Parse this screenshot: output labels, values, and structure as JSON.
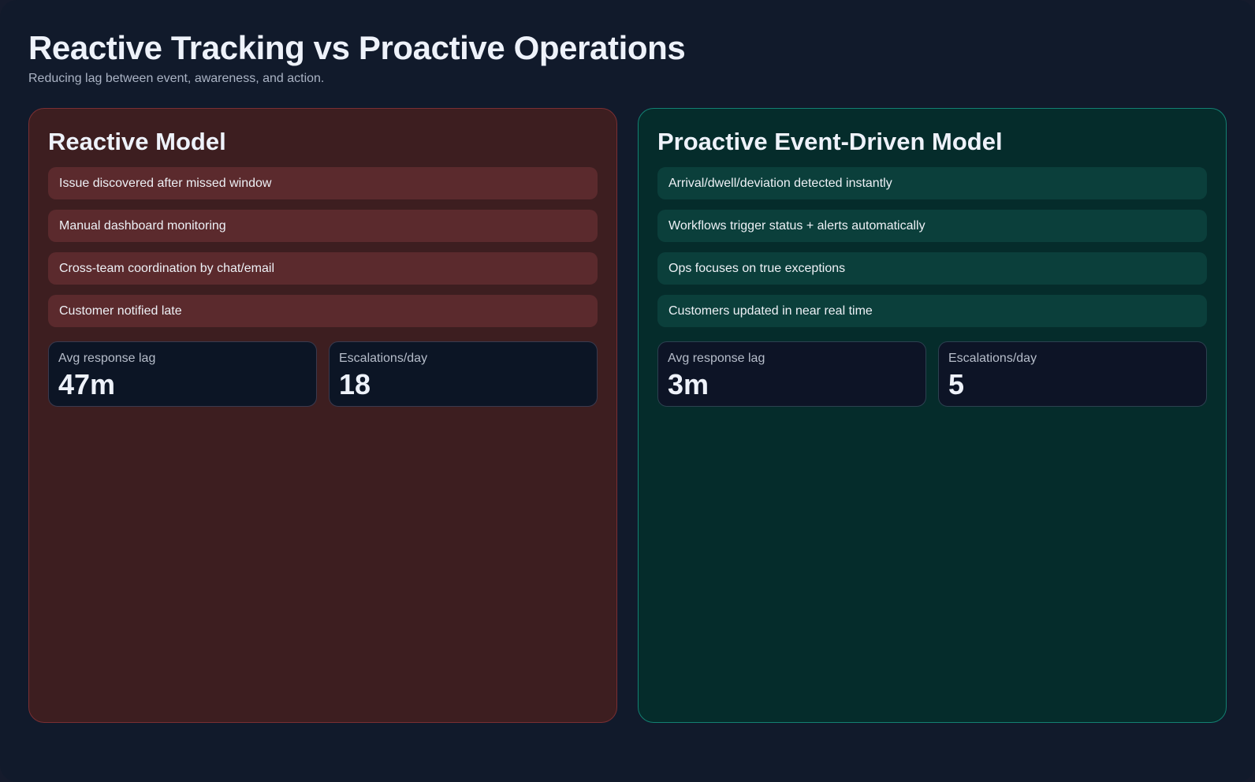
{
  "header": {
    "title": "Reactive Tracking vs Proactive Operations",
    "subtitle": "Reducing lag between event, awareness, and action."
  },
  "panels": {
    "reactive": {
      "title": "Reactive Model",
      "items": [
        "Issue discovered after missed window",
        "Manual dashboard monitoring",
        "Cross-team coordination by chat/email",
        "Customer notified late"
      ],
      "metrics": [
        {
          "label": "Avg response lag",
          "value": "47m"
        },
        {
          "label": "Escalations/day",
          "value": "18"
        }
      ]
    },
    "proactive": {
      "title": "Proactive Event-Driven Model",
      "items": [
        "Arrival/dwell/deviation detected instantly",
        "Workflows trigger status + alerts automatically",
        "Ops focuses on true exceptions",
        "Customers updated in near real time"
      ],
      "metrics": [
        {
          "label": "Avg response lag",
          "value": "3m"
        },
        {
          "label": "Escalations/day",
          "value": "5"
        }
      ]
    }
  },
  "colors": {
    "page_background": "#111a2b",
    "reactive_panel": "#3d1e20",
    "reactive_border": "#7a2f33",
    "reactive_item": "#5b2a2d",
    "proactive_panel": "#052c2b",
    "proactive_border": "#138072",
    "proactive_item": "#0b3f3b",
    "metric_card": "#0c1525"
  }
}
